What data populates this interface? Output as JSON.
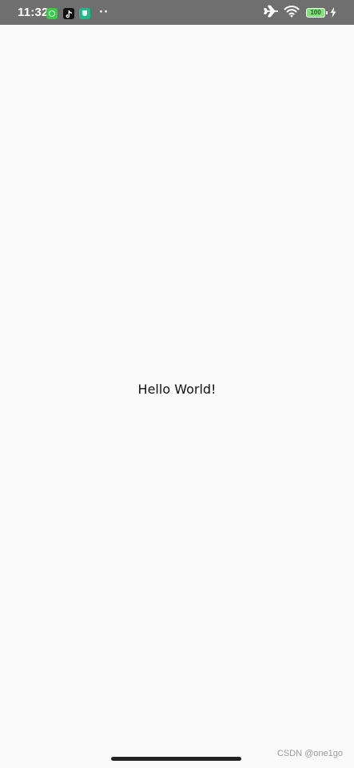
{
  "status_bar": {
    "time": "11:32",
    "background_color": "#6f6f6f",
    "notification_icons": [
      "green-app-icon",
      "tiktok-icon",
      "shield-app-icon"
    ],
    "more_indicator": "··",
    "airplane_mode_icon": "airplane-icon",
    "wifi_icon": "wifi-icon",
    "battery_level": "100",
    "charging_icon": "bolt-icon"
  },
  "main": {
    "text": "Hello World!"
  },
  "watermark": {
    "text": "CSDN @one1go"
  },
  "colors": {
    "background": "#fafafa",
    "battery_fill": "#7ee37a"
  }
}
